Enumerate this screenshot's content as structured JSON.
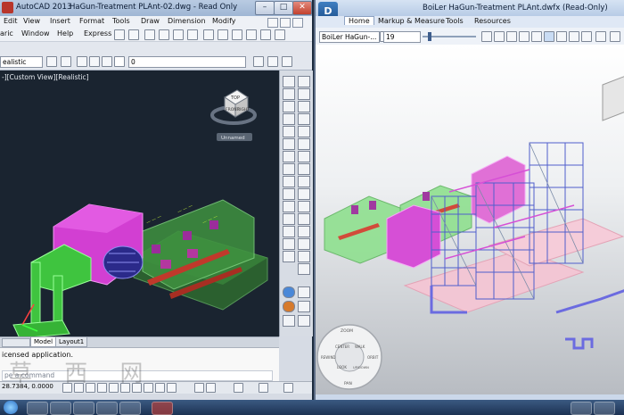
{
  "acad": {
    "title": "AutoCAD 2013",
    "doc_title": "HaGun-Treatment PLAnt-02.dwg - Read Only",
    "menu_row1": [
      "Edit",
      "View",
      "Insert",
      "Format",
      "Tools",
      "Draw",
      "Dimension",
      "Modify"
    ],
    "menu_row2": [
      "aric",
      "Window",
      "Help",
      "Express"
    ],
    "style_combo": "ealistic",
    "layer_value": "0",
    "viewport_label": "-][Custom View][Realistic]",
    "viewcube_top": "TOP",
    "viewcube_front": "FRONT",
    "viewcube_right": "RIGHT",
    "unnamed_label": "Unnamed",
    "tabs": [
      "Model",
      "Layout1"
    ],
    "cmd_history": "icensed application.",
    "cmd_placeholder": "pe a command",
    "coords": "28.7384, 0.0000"
  },
  "nav": {
    "doc_title": "BoiLer HaGun-Treatment PLAnt.dwfx (Read-Only)",
    "ribbon_tabs": [
      "Home",
      "Markup & Measure",
      "Tools",
      "Resources"
    ],
    "sheet_combo": "BoiLer HaGun-...",
    "zoom_value": "19",
    "wheel_labels": [
      "ZOOM",
      "CENTER",
      "WALK",
      "LOOK",
      "UP/DOWN",
      "REWIND",
      "ORBIT",
      "PAN"
    ]
  },
  "watermark": "草 西 网"
}
